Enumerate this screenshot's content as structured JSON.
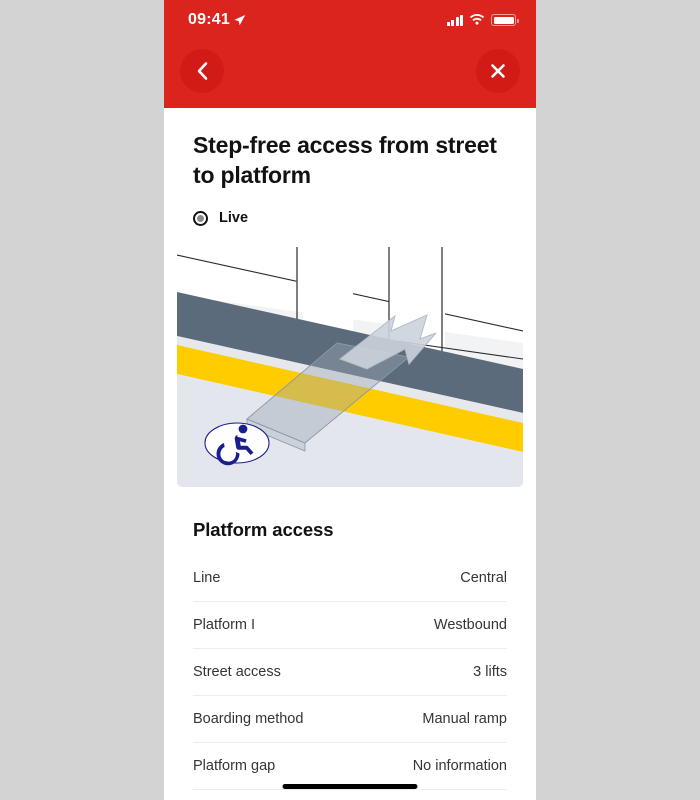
{
  "theme": {
    "header_red": "#dc241f",
    "button_red": "#d21b17",
    "text_dark": "#121212",
    "text_body": "#353535",
    "divider": "#ededed",
    "illustration_bg": "#f2f3f5",
    "platform_edge_yellow": "#ffcc00",
    "platform_band_gray": "#5c6b7b",
    "wheelchair_blue": "#1a1f8f",
    "outer_bg": "#d3d3d3"
  },
  "status_bar": {
    "time": "09:41",
    "location_icon": "location-arrow-icon",
    "signal_icon": "cellular-signal-icon",
    "wifi_icon": "wifi-icon",
    "battery_icon": "battery-full-icon"
  },
  "nav": {
    "back_icon": "chevron-left-icon",
    "back_label": "Back",
    "close_icon": "close-x-icon",
    "close_label": "Close"
  },
  "page": {
    "title": "Step-free access from street to platform",
    "status": {
      "icon": "live-dot-icon",
      "label": "Live"
    },
    "illustration": {
      "name": "step-free-platform-access-illustration",
      "alt": "Isometric illustration of a manual ramp bridging the gap from platform to train doorway, with yellow platform edge line and wheelchair accessibility symbol",
      "wheelchair_icon": "wheelchair-accessibility-icon",
      "direction_icon": "boarding-direction-arrow-icon"
    }
  },
  "section": {
    "heading": "Platform access",
    "rows": [
      {
        "label": "Line",
        "value": "Central"
      },
      {
        "label": "Platform I",
        "value": "Westbound"
      },
      {
        "label": "Street access",
        "value": "3 lifts"
      },
      {
        "label": "Boarding method",
        "value": "Manual ramp"
      },
      {
        "label": "Platform gap",
        "value": "No information"
      }
    ]
  },
  "home_indicator": "home-indicator-bar"
}
